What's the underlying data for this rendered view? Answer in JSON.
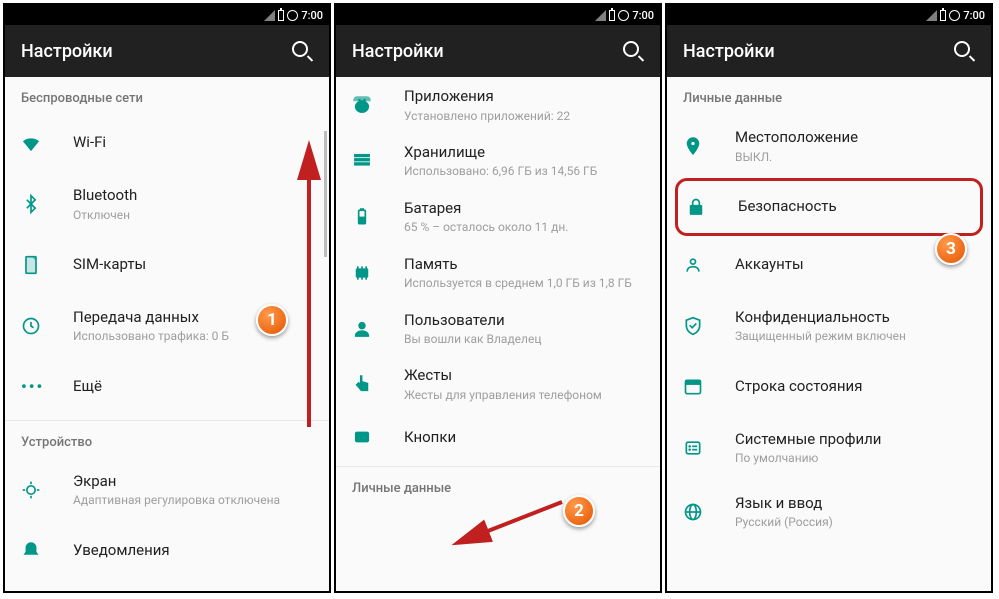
{
  "status": {
    "time": "7:00"
  },
  "appbar": {
    "title": "Настройки"
  },
  "screens": [
    {
      "sections": [
        {
          "header": "Беспроводные сети",
          "items": [
            {
              "icon": "wifi",
              "title": "Wi-Fi",
              "sub": ""
            },
            {
              "icon": "bluetooth",
              "title": "Bluetooth",
              "sub": "Отключен"
            },
            {
              "icon": "sim",
              "title": "SIM-карты",
              "sub": ""
            },
            {
              "icon": "data",
              "title": "Передача данных",
              "sub": "Использовано трафика: 0 Б"
            },
            {
              "icon": "more",
              "title": "Ещё",
              "sub": ""
            }
          ]
        },
        {
          "header": "Устройство",
          "items": [
            {
              "icon": "display",
              "title": "Экран",
              "sub": "Адаптивная регулировка отключена"
            },
            {
              "icon": "bell",
              "title": "Уведомления",
              "sub": ""
            }
          ]
        }
      ]
    },
    {
      "sections": [
        {
          "items": [
            {
              "icon": "apps",
              "title": "Приложения",
              "sub": "Установлено приложений: 22"
            },
            {
              "icon": "storage",
              "title": "Хранилище",
              "sub": "Использовано: 6,96 ГБ из 14,56 ГБ"
            },
            {
              "icon": "battery",
              "title": "Батарея",
              "sub": "65 % – осталось около 11 дн."
            },
            {
              "icon": "memory",
              "title": "Память",
              "sub": "Используется в среднем 1,0 ГБ из 1,8 ГБ"
            },
            {
              "icon": "users",
              "title": "Пользователи",
              "sub": "Вы вошли как Владелец"
            },
            {
              "icon": "gesture",
              "title": "Жесты",
              "sub": "Жесты для управления телефоном"
            },
            {
              "icon": "keys",
              "title": "Кнопки",
              "sub": ""
            }
          ]
        },
        {
          "header": "Личные данные",
          "items": []
        }
      ]
    },
    {
      "sections": [
        {
          "header": "Личные данные",
          "items": [
            {
              "icon": "location",
              "title": "Местоположение",
              "sub": "ВЫКЛ."
            },
            {
              "icon": "lock",
              "title": "Безопасность",
              "sub": "",
              "highlight": true
            },
            {
              "icon": "account",
              "title": "Аккаунты",
              "sub": ""
            },
            {
              "icon": "shield",
              "title": "Конфиденциальность",
              "sub": "Защищенный режим включен"
            },
            {
              "icon": "statusbar",
              "title": "Строка состояния",
              "sub": ""
            },
            {
              "icon": "profiles",
              "title": "Системные профили",
              "sub": "По умолчанию"
            },
            {
              "icon": "lang",
              "title": "Язык и ввод",
              "sub": "Русский (Россия)"
            }
          ]
        }
      ]
    }
  ],
  "badges": {
    "b1": "1",
    "b2": "2",
    "b3": "3"
  }
}
